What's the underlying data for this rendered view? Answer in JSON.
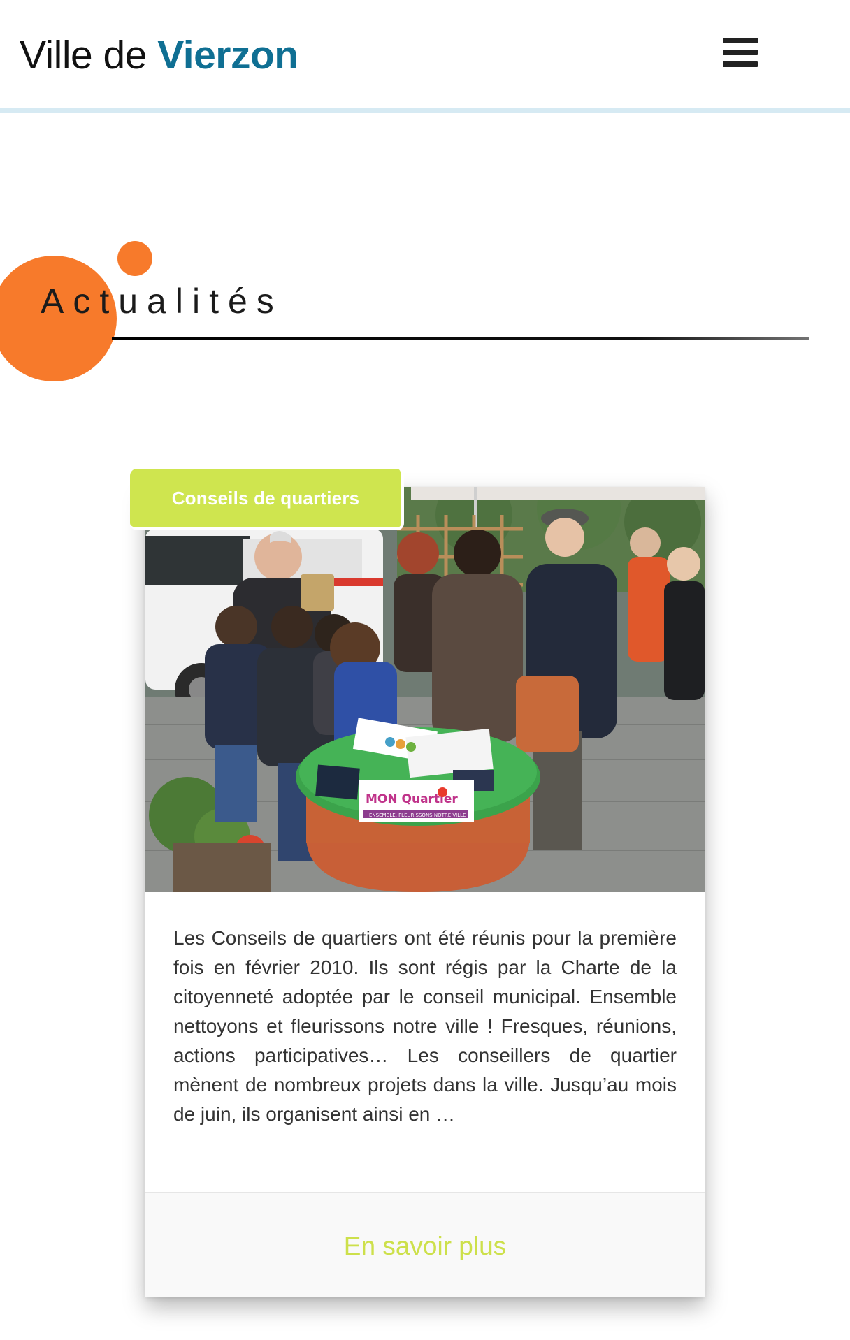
{
  "header": {
    "logo_prefix": "Ville de ",
    "logo_city": "Vierzon",
    "menu_icon": "hamburger-menu-icon"
  },
  "section": {
    "title": "Actualités"
  },
  "news_card": {
    "category": "Conseils de quartiers",
    "photo_sign_text": "MON Quartier",
    "photo_sign_subtext": "ENSEMBLE, FLEURISSONS NOTRE VILLE",
    "excerpt": "Les Conseils de quartiers ont été réunis pour la première fois en février 2010. Ils sont régis par la Charte de la citoyenneté adoptée par le conseil municipal. Ensemble nettoyons et fleurissons notre ville ! Fresques, réunions, actions participatives… Les conseillers de quartier mènent de nombreux projets dans la ville. Jusqu’au mois de juin, ils organisent ainsi en …",
    "more_label": "En savoir plus"
  },
  "colors": {
    "brand_blue": "#0f6f93",
    "accent_orange": "#f77a2b",
    "tag_green": "#cfe54f",
    "link_green": "#cde04b",
    "header_rule": "#d6eaf3"
  }
}
